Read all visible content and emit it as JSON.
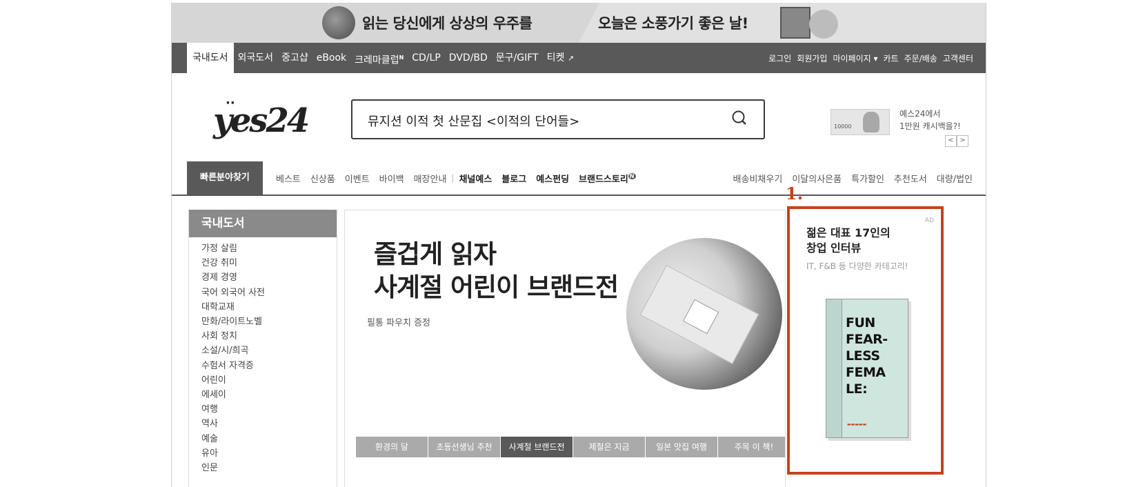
{
  "top_banner": {
    "left_text": "읽는 당신에게 상상의 우주를",
    "right_text": "오늘은 소풍가기 좋은 날!"
  },
  "gnb": {
    "items": [
      "국내도서",
      "외국도서",
      "중고샵",
      "eBook",
      "크레마클럽",
      "CD/LP",
      "DVD/BD",
      "문구/GIFT",
      "티켓"
    ],
    "crema_badge": "N",
    "ticket_arrow": "↗",
    "util": [
      "로그인",
      "회원가입",
      "마이페이지 ▾",
      "카트",
      "주문/배송",
      "고객센터"
    ]
  },
  "header": {
    "logo": "yes24",
    "search_value": "뮤지션 이적 첫 산문집 <이적의 단어들>",
    "promo_line1": "예스24에서",
    "promo_line2": "1만원 캐시백을?!",
    "promo_bill": "10000",
    "prev": "<",
    "next": ">"
  },
  "lnb": {
    "quick": "빠른분야찾기",
    "items": [
      "베스트",
      "신상품",
      "이벤트",
      "바이백",
      "매장안내"
    ],
    "bold_items": [
      "채널예스",
      "블로그",
      "예스펀딩",
      "브랜드스토리"
    ],
    "brand_badge": "N",
    "separator": "|",
    "right_items": [
      "배송비채우기",
      "이달의사은품",
      "특가할인",
      "추천도서",
      "대량/법인"
    ]
  },
  "sidebar": {
    "title": "국내도서",
    "items": [
      "가정 살림",
      "건강 취미",
      "경제 경영",
      "국어 외국어 사전",
      "대학교재",
      "만화/라이트노벨",
      "사회 정치",
      "소설/시/희곡",
      "수험서 자격증",
      "어린이",
      "에세이",
      "여행",
      "역사",
      "예술",
      "유아",
      "인문"
    ]
  },
  "hero": {
    "title_line1": "즐겁게 읽자",
    "title_line2": "사계절 어린이 브랜드전",
    "subtitle": "필통 파우치 증정",
    "tabs": [
      "환경의 달",
      "초등선생님 추천",
      "사계절 브랜드전",
      "제철은 지금",
      "일본 맛집 여행",
      "주목 이 책!"
    ],
    "active_tab": 2
  },
  "ad": {
    "number_label": "1.",
    "tag": "AD",
    "title_line1": "젊은 대표 17인의",
    "title_line2": "창업 인터뷰",
    "subtitle": "IT, F&B 등 다양한 카테고리!",
    "book_title": "FUN\nFEAR-\nLESS\nFEMA\nLE:",
    "accent_color": "#c9401c"
  }
}
